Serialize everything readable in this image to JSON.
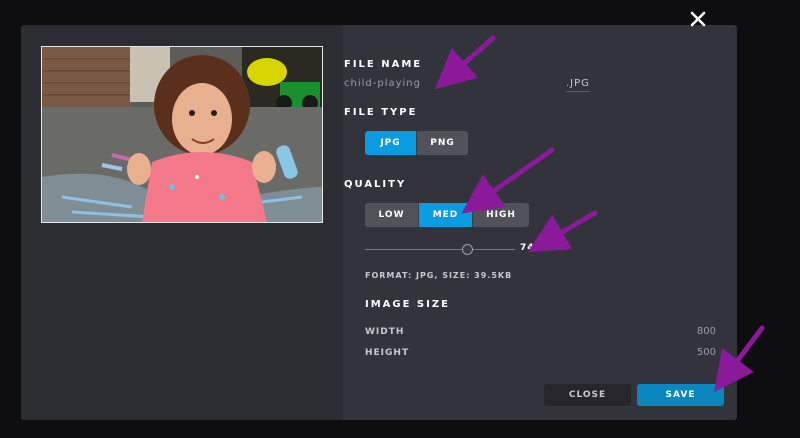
{
  "dialog": {
    "close_icon": "close-x-icon",
    "photo": {
      "alt": "child-playing",
      "subject": "toddler playing with sidewalk chalk"
    },
    "file_name": {
      "label": "FILE NAME",
      "value": "child-playing",
      "extension": ".JPG"
    },
    "file_type": {
      "label": "FILE TYPE",
      "options": [
        {
          "label": "JPG",
          "active": true
        },
        {
          "label": "PNG",
          "active": false
        }
      ]
    },
    "quality": {
      "label": "QUALITY",
      "options": [
        {
          "label": "LOW",
          "active": false
        },
        {
          "label": "MED",
          "active": true
        },
        {
          "label": "HIGH",
          "active": false
        }
      ],
      "slider_value": 0.68,
      "percent_label": "74%"
    },
    "format_info": "FORMAT: JPG, SIZE: 39.5KB",
    "image_size": {
      "label": "IMAGE SIZE",
      "width_label": "WIDTH",
      "width_value": "800",
      "height_label": "HEIGHT",
      "height_value": "500"
    },
    "buttons": {
      "close": "CLOSE",
      "save": "SAVE"
    }
  },
  "colors": {
    "accent": "#0b9be0",
    "save": "#0b86bf",
    "annotation_arrow": "#8b1a9a",
    "backdrop": "#0e0e11",
    "panel": "#33333b"
  }
}
